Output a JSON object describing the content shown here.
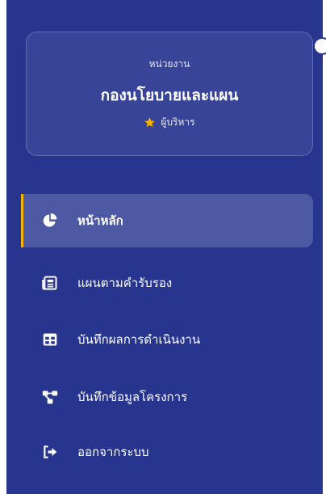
{
  "org": {
    "label": "หน่วยงาน",
    "name": "กองนโยบายและแผน",
    "role": "ผู้บริหาร",
    "role_icon": "star-icon"
  },
  "menu": {
    "items": [
      {
        "label": "หน้าหลัก",
        "icon": "pie-chart-icon",
        "active": true
      },
      {
        "label": "แผนตามคำรับรอง",
        "icon": "newspaper-icon",
        "active": false
      },
      {
        "label": "บันทึกผลการดำเนินงาน",
        "icon": "table-icon",
        "active": false
      },
      {
        "label": "บันทึกข้อมูลโครงการ",
        "icon": "project-diagram-icon",
        "active": false
      },
      {
        "label": "ออกจากระบบ",
        "icon": "sign-out-icon",
        "active": false
      }
    ]
  },
  "colors": {
    "sidebar_bg": "#27358f",
    "active_accent": "#f5b400",
    "star": "#f5b400"
  }
}
